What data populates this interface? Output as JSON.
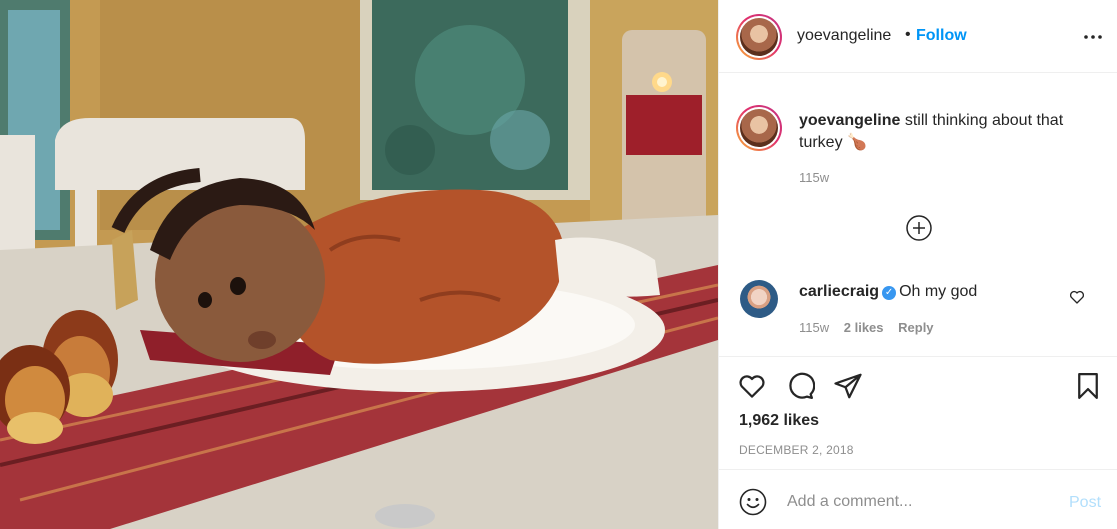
{
  "post": {
    "author": "yoevangeline",
    "follow_label": "Follow",
    "separator": "•",
    "caption_text": "still thinking about that turkey",
    "caption_emoji": "🍗",
    "caption_time": "115w",
    "likes": "1,962 likes",
    "date": "DECEMBER 2, 2018"
  },
  "comments": [
    {
      "author": "carliecraig",
      "verified": true,
      "verified_glyph": "✓",
      "text": "Oh my god",
      "time": "115w",
      "likes": "2 likes",
      "reply_label": "Reply"
    }
  ],
  "composer": {
    "placeholder": "Add a comment...",
    "post_label": "Post"
  },
  "colors": {
    "link_blue": "#0095f6",
    "post_disabled": "#b2dffc",
    "muted": "#8e8e8e",
    "text": "#262626"
  },
  "icons": [
    "more-icon",
    "load-more-icon",
    "heart-icon",
    "comment-icon",
    "share-icon",
    "save-icon",
    "emoji-icon",
    "verified-icon"
  ]
}
